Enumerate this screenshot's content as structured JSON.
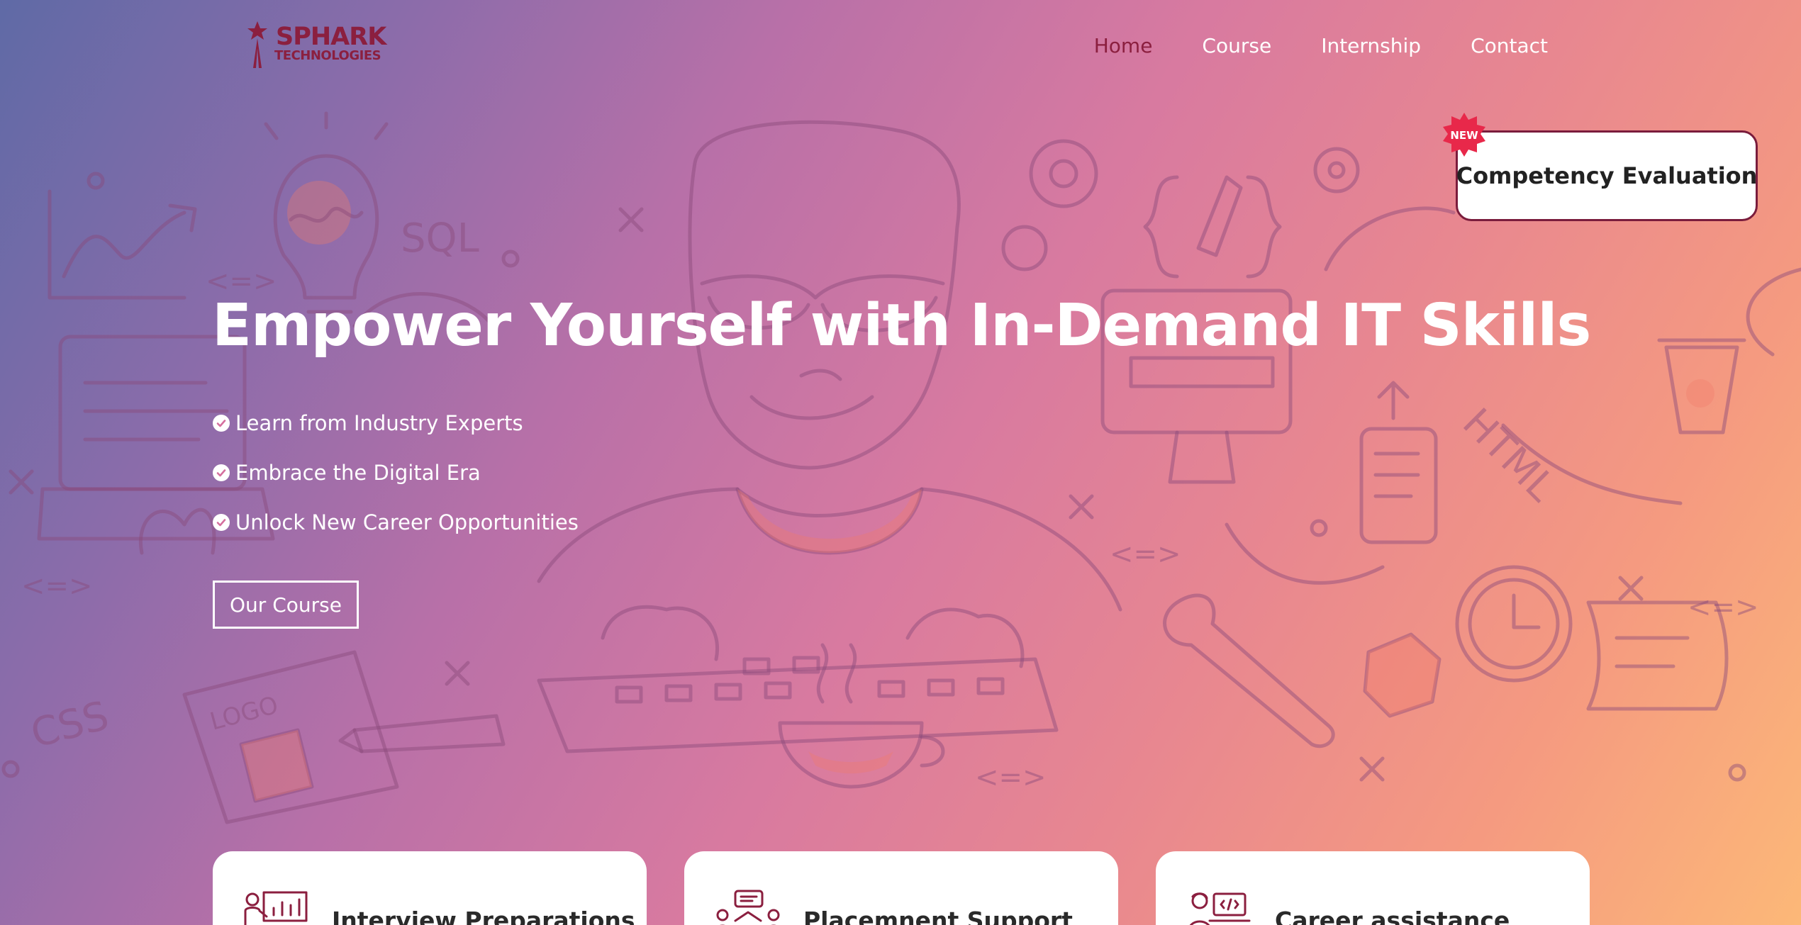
{
  "brand": {
    "name_top": "SPHARK",
    "name_bottom": "TECHNOLOGIES",
    "color": "#8b1f3f"
  },
  "nav": {
    "items": [
      {
        "label": "Home",
        "active": true
      },
      {
        "label": "Course",
        "active": false
      },
      {
        "label": "Internship",
        "active": false
      },
      {
        "label": "Contact",
        "active": false
      }
    ]
  },
  "promo": {
    "badge": "NEW",
    "label": "Competency Evaluation",
    "badge_color": "#e8284a"
  },
  "hero": {
    "title": "Empower Yourself with In-Demand IT Skills",
    "features": [
      "Learn from Industry Experts",
      "Embrace the Digital Era",
      "Unlock New Career Opportunities"
    ],
    "cta": "Our Course"
  },
  "cards": [
    {
      "title": "Interview Preparations",
      "icon": "presentation-chart-icon"
    },
    {
      "title": "Placemnent Support",
      "icon": "team-discussion-icon"
    },
    {
      "title": "Career assistance",
      "icon": "developer-laptop-icon"
    }
  ],
  "colors": {
    "gradient_start": "#5f6aa6",
    "gradient_mid": "#d87aa0",
    "gradient_end": "#fcb878",
    "accent": "#8b1f3f"
  }
}
